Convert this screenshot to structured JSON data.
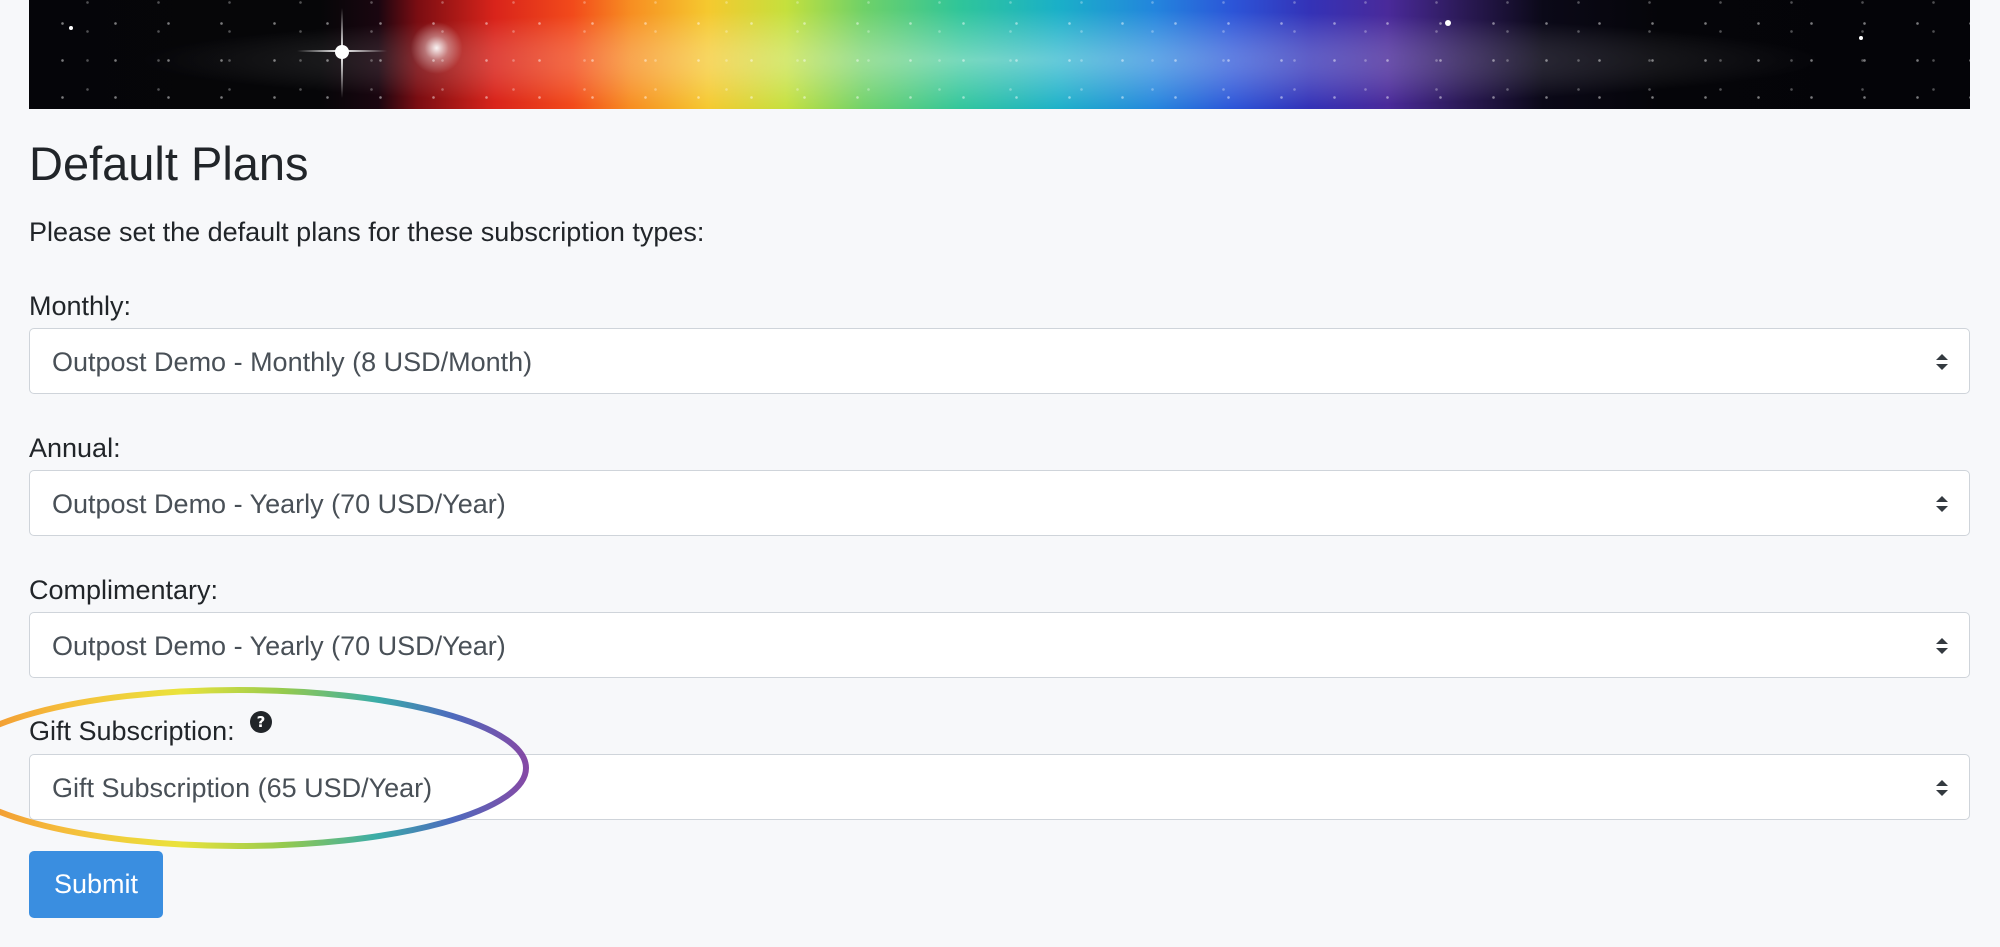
{
  "page": {
    "title": "Default Plans",
    "intro": "Please set the default plans for these subscription types:"
  },
  "fields": {
    "monthly": {
      "label": "Monthly:",
      "selected": "Outpost Demo - Monthly (8 USD/Month)"
    },
    "annual": {
      "label": "Annual:",
      "selected": "Outpost Demo - Yearly (70 USD/Year)"
    },
    "complimentary": {
      "label": "Complimentary:",
      "selected": "Outpost Demo - Yearly (70 USD/Year)"
    },
    "gift": {
      "label": "Gift Subscription:",
      "selected": "Gift Subscription (65 USD/Year)",
      "help_icon": "?"
    }
  },
  "actions": {
    "submit_label": "Submit"
  },
  "colors": {
    "primary": "#3a8ee0",
    "text": "#212529",
    "select_text": "#495057",
    "border": "#cfd4da",
    "background": "#f7f8fa"
  },
  "icons": {
    "select_caret": "caret-up-down-icon",
    "help": "question-circle-icon",
    "highlight": "rainbow-ellipse-annotation"
  }
}
